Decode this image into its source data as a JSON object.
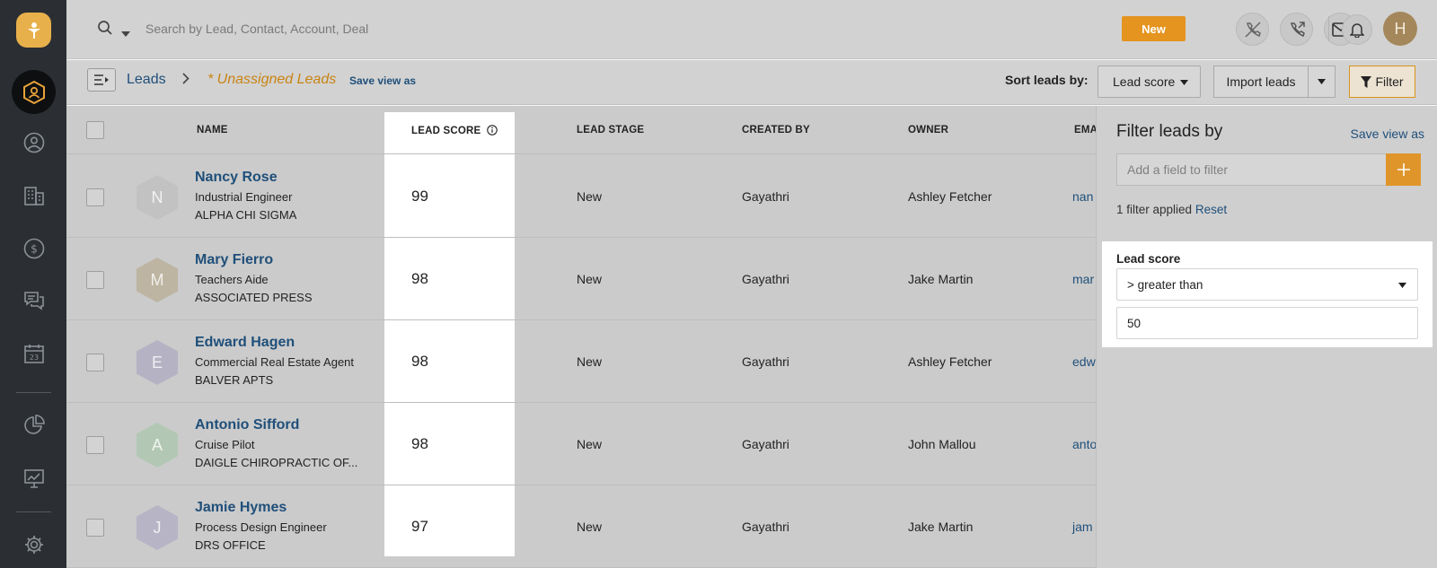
{
  "topbar": {
    "search_placeholder": "Search by Lead, Contact, Account, Deal",
    "new_label": "New",
    "avatar_initial": "H"
  },
  "subheader": {
    "breadcrumb_root": "Leads",
    "breadcrumb_view": "* Unassigned Leads",
    "save_view_label": "Save view as",
    "sort_label": "Sort leads by:",
    "sort_value": "Lead score",
    "import_label": "Import leads",
    "filter_label": "Filter"
  },
  "table": {
    "headers": {
      "name": "NAME",
      "lead_score": "LEAD SCORE",
      "lead_stage": "LEAD STAGE",
      "created_by": "CREATED BY",
      "owner": "OWNER",
      "email": "EMA"
    },
    "rows": [
      {
        "initial": "N",
        "name": "Nancy Rose",
        "title": "Industrial Engineer",
        "company": "ALPHA CHI SIGMA",
        "score": "99",
        "stage": "New",
        "created_by": "Gayathri",
        "owner": "Ashley Fetcher",
        "email": "nan",
        "avatar_color": "#c2c2c2"
      },
      {
        "initial": "M",
        "name": "Mary Fierro",
        "title": "Teachers Aide",
        "company": "ASSOCIATED PRESS",
        "score": "98",
        "stage": "New",
        "created_by": "Gayathri",
        "owner": "Jake Martin",
        "email": "mar",
        "avatar_color": "#bdb4a2"
      },
      {
        "initial": "E",
        "name": "Edward Hagen",
        "title": "Commercial Real Estate Agent",
        "company": "BALVER APTS",
        "score": "98",
        "stage": "New",
        "created_by": "Gayathri",
        "owner": "Ashley Fetcher",
        "email": "edw",
        "avatar_color": "#b4b2c3"
      },
      {
        "initial": "A",
        "name": "Antonio Sifford",
        "title": "Cruise Pilot",
        "company": "DAIGLE CHIROPRACTIC OF...",
        "score": "98",
        "stage": "New",
        "created_by": "Gayathri",
        "owner": "John Mallou",
        "email": "anto",
        "avatar_color": "#b2c8b4"
      },
      {
        "initial": "J",
        "name": "Jamie Hymes",
        "title": "Process Design Engineer",
        "company": "DRS OFFICE",
        "score": "97",
        "stage": "New",
        "created_by": "Gayathri",
        "owner": "Jake Martin",
        "email": "jam",
        "avatar_color": "#b7b4c6"
      }
    ]
  },
  "filter_panel": {
    "title": "Filter leads by",
    "save_view_label": "Save view as",
    "add_placeholder": "Add a field to filter",
    "applied_text": "1 filter applied",
    "reset_label": "Reset",
    "field_label": "Lead score",
    "operator": "> greater than",
    "value": "50"
  },
  "colors": {
    "accent": "#e4941f",
    "link": "#1f4f7a",
    "sidebar": "#2b2f33"
  }
}
